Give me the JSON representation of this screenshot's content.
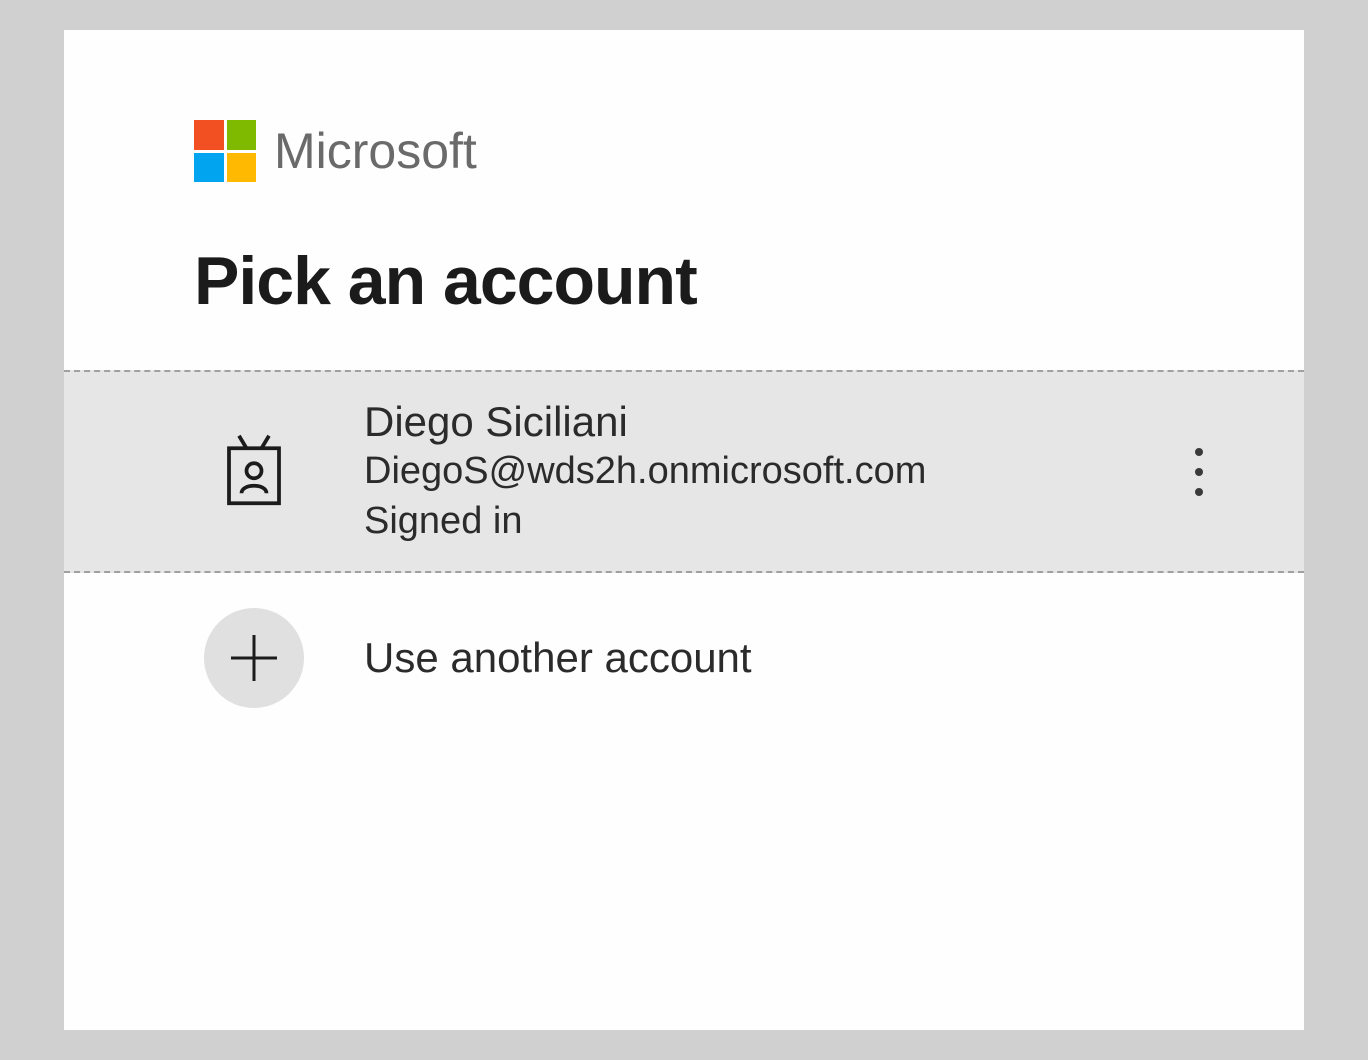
{
  "brand": "Microsoft",
  "title": "Pick an account",
  "logo_colors": {
    "top_left": "#f25022",
    "top_right": "#7fba00",
    "bottom_left": "#00a4ef",
    "bottom_right": "#ffb900"
  },
  "accounts": [
    {
      "name": "Diego Siciliani",
      "email": "DiegoS@wds2h.onmicrosoft.com",
      "status": "Signed in",
      "selected": true
    }
  ],
  "other_account_label": "Use another account"
}
